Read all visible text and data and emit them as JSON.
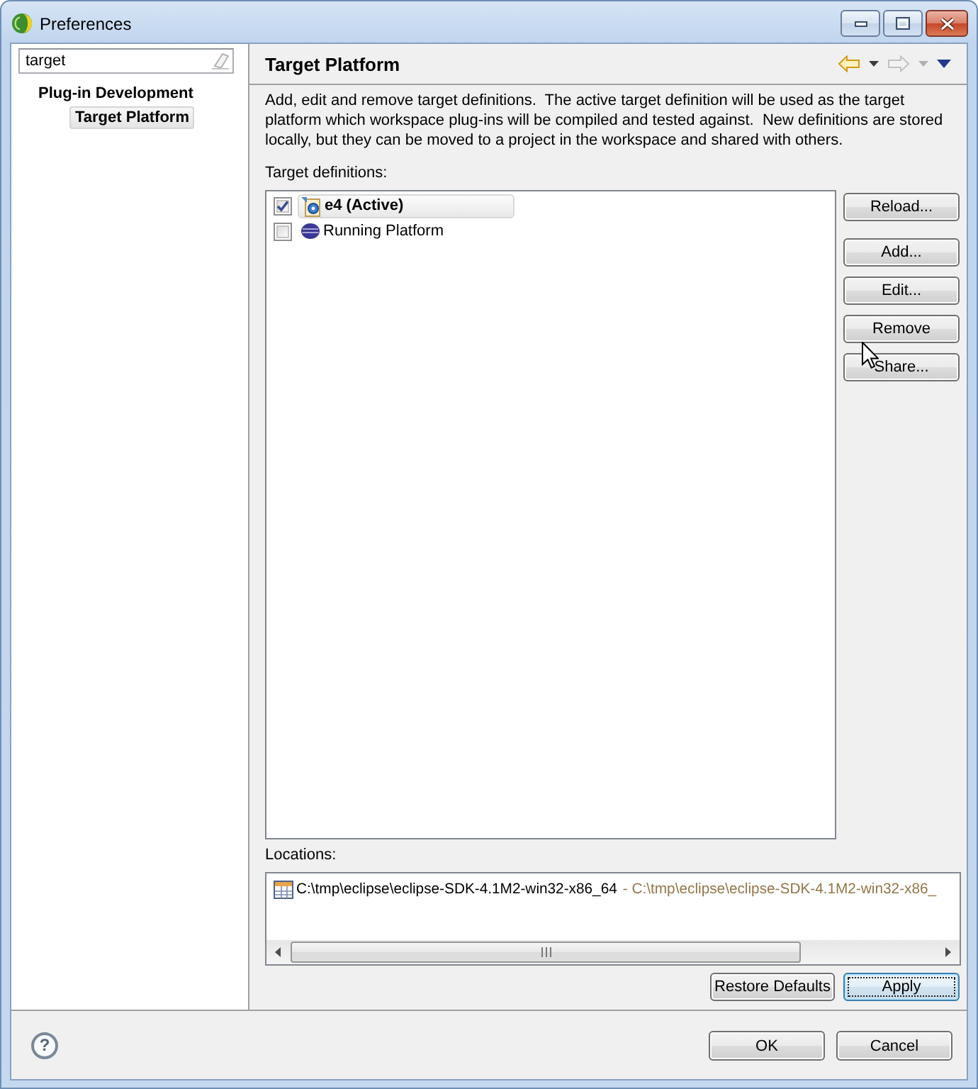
{
  "window": {
    "title": "Preferences"
  },
  "filter": {
    "value": "target"
  },
  "tree": [
    {
      "label": "Plug-in Development",
      "selected": false,
      "children": [
        {
          "label": "Target Platform",
          "selected": true
        }
      ]
    }
  ],
  "page": {
    "title": "Target Platform",
    "toolbar": [
      {
        "kind": "back",
        "disabled": false
      },
      {
        "kind": "dropdown",
        "disabled": false
      },
      {
        "kind": "forward",
        "disabled": true
      },
      {
        "kind": "dropdown",
        "disabled": true
      },
      {
        "kind": "menu",
        "disabled": false
      }
    ],
    "description": "Add, edit and remove target definitions.  The active target definition will be used as the target platform which workspace plug-ins will be compiled and tested against.  New definitions are stored locally, but they can be moved to a project in the workspace and shared with others.",
    "definitions_label": "Target definitions:",
    "definitions": [
      {
        "kind": "target",
        "name": "e4 (Active)",
        "active": true,
        "checked": true,
        "selected": true
      },
      {
        "kind": "running",
        "name": "Running Platform",
        "active": false,
        "checked": false,
        "selected": false
      }
    ],
    "definition_buttons": [
      "Reload...",
      "Add...",
      "Edit...",
      "Remove",
      "Share..."
    ],
    "locations_label": "Locations:",
    "locations": [
      {
        "path": "C:\\tmp\\eclipse\\eclipse-SDK-4.1M2-win32-x86_64",
        "detail": "- C:\\tmp\\eclipse\\eclipse-SDK-4.1M2-win32-x86_"
      }
    ],
    "page_buttons": [
      {
        "label": "Restore Defaults",
        "focused": false
      },
      {
        "label": "Apply",
        "focused": true
      }
    ]
  },
  "help": "?",
  "dialog_buttons": [
    "OK",
    "Cancel"
  ]
}
